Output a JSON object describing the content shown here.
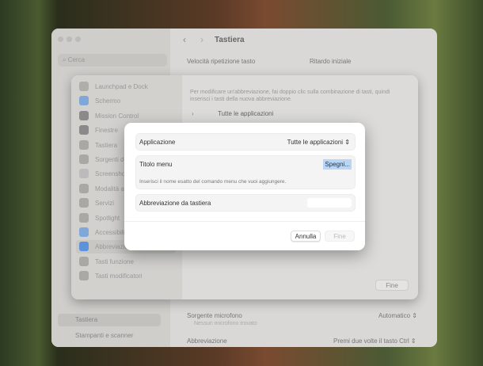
{
  "window": {
    "title": "Tastiera",
    "search_placeholder": "Cerca",
    "sidebar": [
      "Tastiera",
      "Stampanti e scanner"
    ],
    "labels": {
      "repeat_speed": "Velocità ripetizione tasto",
      "initial_delay": "Ritardo iniziale",
      "mic_source": "Sorgente microfono",
      "mic_warning": "Nessun microfono trovato",
      "mic_value": "Automatico",
      "shortcut": "Abbreviazione",
      "shortcut_value": "Premi due volte il tasto Ctrl"
    }
  },
  "sheet": {
    "items": [
      "Launchpad e Dock",
      "Schermo",
      "Mission Control",
      "Finestre",
      "Tastiera",
      "Sorgenti di...",
      "Screenshot",
      "Modalità a...",
      "Servizi",
      "Spotlight",
      "Accessibilità",
      "Abbreviazioni app",
      "Tasti funzione",
      "Tasti modificatori"
    ],
    "selected": 11,
    "hint": "Per modificare un'abbreviazione, fai doppio clic sulla combinazione di tasti, quindi inserisci i tasti della nuova abbreviazione.",
    "group": "Tutte le applicazioni",
    "done": "Fine"
  },
  "dialog": {
    "app_label": "Applicazione",
    "app_value": "Tutte le applicazioni",
    "menu_label": "Titolo menu",
    "menu_value": "Spegni...",
    "menu_hint": "Inserisci il nome esatto del comando menu che vuoi aggiungere.",
    "shortcut_label": "Abbreviazione da tastiera",
    "cancel": "Annulla",
    "done": "Fine"
  }
}
